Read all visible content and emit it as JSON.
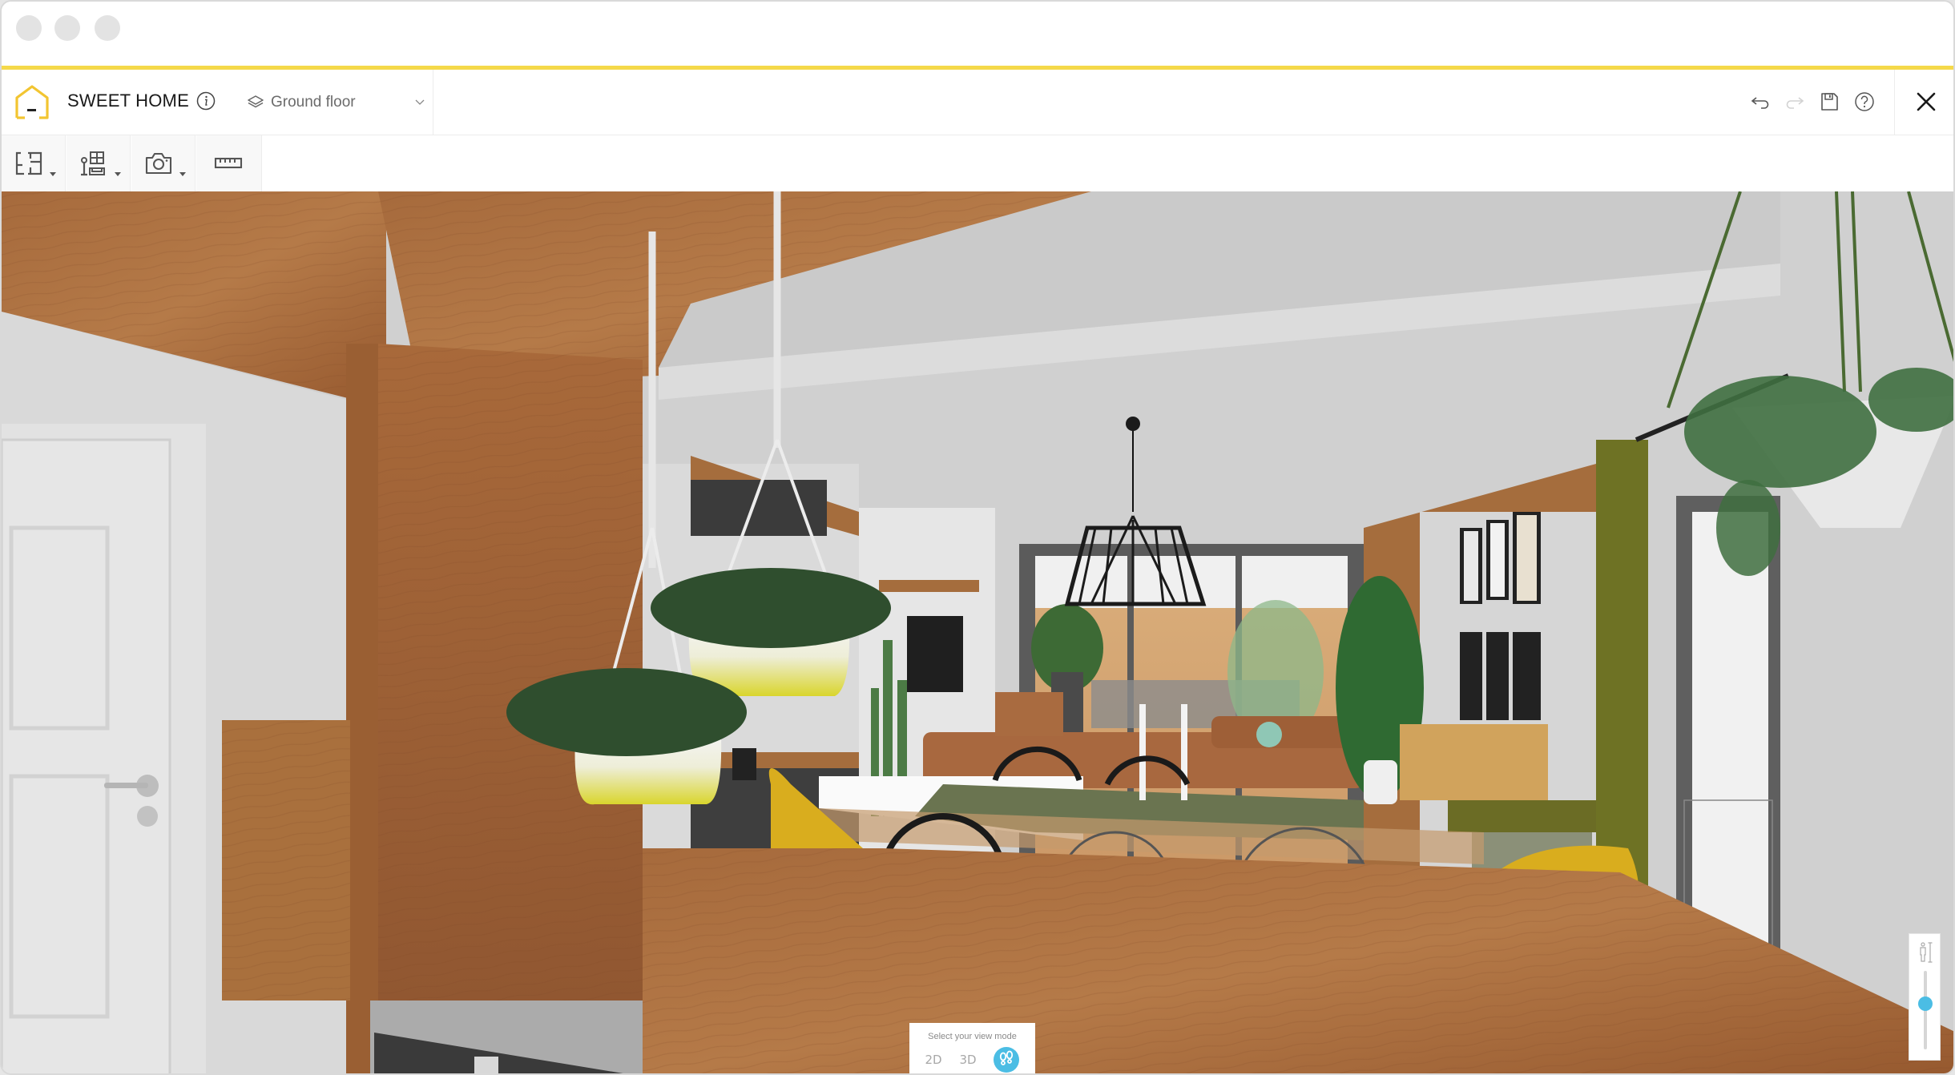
{
  "window": {
    "traffic_lights": [
      "close",
      "minimize",
      "zoom"
    ],
    "accent_color": "#f5d94a"
  },
  "header": {
    "app_title": "SWEET HOME",
    "info_icon": "info-icon",
    "floor_selector": {
      "icon": "layers-icon",
      "selected": "Ground floor"
    },
    "actions": [
      {
        "name": "undo",
        "icon": "undo-icon",
        "enabled": true
      },
      {
        "name": "redo",
        "icon": "redo-icon",
        "enabled": false
      },
      {
        "name": "save",
        "icon": "save-icon",
        "enabled": true
      },
      {
        "name": "help",
        "icon": "help-icon",
        "enabled": true
      }
    ],
    "close_icon": "close-icon"
  },
  "toolbar": {
    "tools": [
      {
        "name": "floor-plan",
        "icon": "floor-plan-icon",
        "has_dropdown": true
      },
      {
        "name": "furniture",
        "icon": "furniture-icon",
        "has_dropdown": true
      },
      {
        "name": "camera",
        "icon": "camera-icon",
        "has_dropdown": true
      },
      {
        "name": "measure",
        "icon": "ruler-icon",
        "has_dropdown": false
      }
    ]
  },
  "view_mode": {
    "title": "Select your view mode",
    "options": [
      {
        "label": "2D",
        "active": false
      },
      {
        "label": "3D",
        "active": false
      },
      {
        "label": "walk",
        "icon": "footsteps-icon",
        "active": true
      }
    ],
    "active_color": "#4bbde4"
  },
  "camera_height": {
    "icon": "person-height-icon",
    "value_fraction_from_top": 0.42
  },
  "scene": {
    "description": "3D walkthrough render of open-plan living and dining room",
    "colors": {
      "wood": "#a8693a",
      "wall": "#d2d2d2",
      "ceiling": "#cbcbcb",
      "door": "#e4e4e4",
      "sofa": "#a5643d",
      "yellow_chair": "#d9ad1e",
      "olive_curtain": "#6d7126",
      "table_runner": "#6a7450"
    }
  }
}
